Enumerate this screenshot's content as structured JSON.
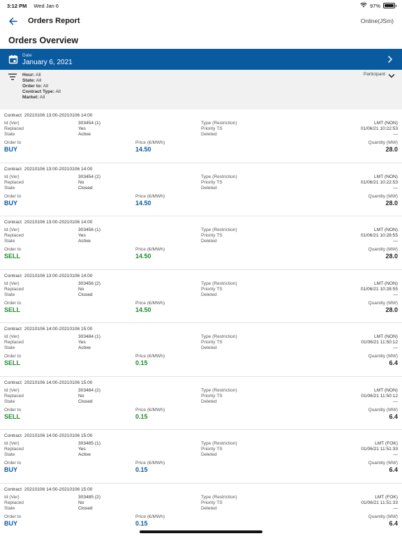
{
  "status": {
    "time": "3:12 PM",
    "date": "Wed Jan 6",
    "battery": "97%",
    "battery_level": 0.97
  },
  "nav": {
    "title": "Orders Report",
    "user": "Online(JSm)"
  },
  "page": {
    "title": "Orders Overview"
  },
  "date_selector": {
    "label": "Date",
    "value": "January 6, 2021"
  },
  "filters": {
    "items": [
      {
        "key": "Hour:",
        "value": "All"
      },
      {
        "key": "State:",
        "value": "All"
      },
      {
        "key": "Order to:",
        "value": "All"
      },
      {
        "key": "Contract Type:",
        "value": "All"
      },
      {
        "key": "Market:",
        "value": "All"
      }
    ],
    "participant_label": "Participant"
  },
  "labels": {
    "contract": "Contract",
    "id_ver": "Id (Ver)",
    "replaced": "Replaced",
    "state": "State",
    "type": "Type (Restriction)",
    "priority": "Priority TS",
    "deleted": "Deleted",
    "order_to": "Order to",
    "price": "Price (€/MWh)",
    "quantity": "Quantity (MW)"
  },
  "orders": [
    {
      "contract": "20210106 13:00-20210106 14:00",
      "id": "303454 (1)",
      "replaced": "Yes",
      "state": "Active",
      "type": "LMT (NON)",
      "priority": "01/06/21 10:22:53",
      "deleted": "—",
      "order_to": "BUY",
      "price": "14.50",
      "quantity": "28.0"
    },
    {
      "contract": "20210106 13:00-20210106 14:00",
      "id": "303454 (2)",
      "replaced": "No",
      "state": "Closed",
      "type": "LMT (NON)",
      "priority": "01/06/21 10:22:53",
      "deleted": "—",
      "order_to": "BUY",
      "price": "14.50",
      "quantity": "28.0"
    },
    {
      "contract": "20210106 13:00-20210106 14:00",
      "id": "303456 (1)",
      "replaced": "Yes",
      "state": "Active",
      "type": "LMT (NON)",
      "priority": "01/06/21 10:28:55",
      "deleted": "—",
      "order_to": "SELL",
      "price": "14.50",
      "quantity": "28.0"
    },
    {
      "contract": "20210106 13:00-20210106 14:00",
      "id": "303456 (2)",
      "replaced": "No",
      "state": "Closed",
      "type": "LMT (NON)",
      "priority": "01/06/21 10:28:55",
      "deleted": "—",
      "order_to": "SELL",
      "price": "14.50",
      "quantity": "28.0"
    },
    {
      "contract": "20210106 14:00-20210106 15:00",
      "id": "303484 (1)",
      "replaced": "Yes",
      "state": "Active",
      "type": "LMT (NON)",
      "priority": "01/06/21 11:50:12",
      "deleted": "—",
      "order_to": "SELL",
      "price": "0.15",
      "quantity": "6.4"
    },
    {
      "contract": "20210106 14:00-20210106 15:00",
      "id": "303484 (2)",
      "replaced": "No",
      "state": "Closed",
      "type": "LMT (NON)",
      "priority": "01/06/21 11:50:12",
      "deleted": "—",
      "order_to": "SELL",
      "price": "0.15",
      "quantity": "6.4"
    },
    {
      "contract": "20210106 14:00-20210106 15:00",
      "id": "303485 (1)",
      "replaced": "Yes",
      "state": "Active",
      "type": "LMT (FOK)",
      "priority": "01/06/21 11:51:33",
      "deleted": "—",
      "order_to": "BUY",
      "price": "0.15",
      "quantity": "6.4"
    },
    {
      "contract": "20210106 14:00-20210106 15:00",
      "id": "303485 (2)",
      "replaced": "No",
      "state": "Closed",
      "type": "LMT (FOK)",
      "priority": "01/06/21 11:51:33",
      "deleted": "—",
      "order_to": "BUY",
      "price": "0.15",
      "quantity": "6.4"
    }
  ],
  "colors": {
    "primary": "#0a5aa0",
    "buy": "#0a5aa0",
    "sell": "#1e8a2e",
    "filter_bg": "#f1f1f1"
  },
  "icons": {
    "back": "arrow-left-icon",
    "calendar": "calendar-icon",
    "next": "chevron-right-icon",
    "filter": "filter-icon",
    "expand": "chevron-down-icon",
    "wifi": "wifi-icon",
    "battery": "battery-icon"
  }
}
